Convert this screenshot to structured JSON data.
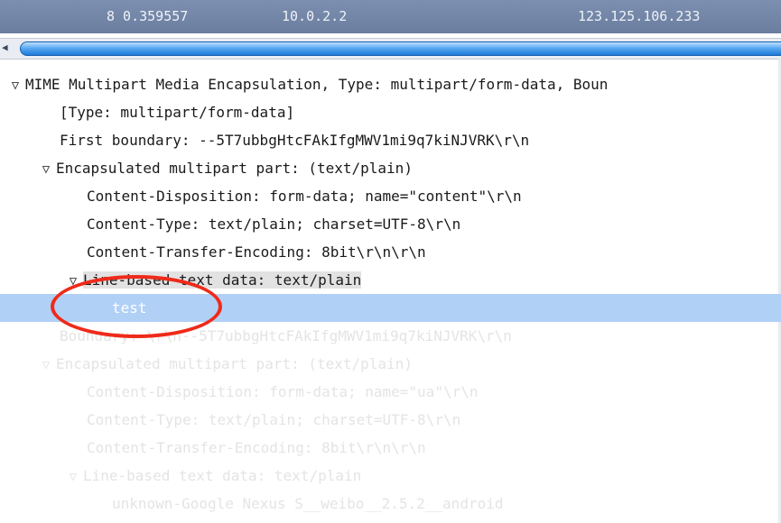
{
  "packet_row": {
    "number_time": "8 0.359557",
    "source": "10.0.2.2",
    "destination": "123.125.106.233"
  },
  "tree": {
    "mime_header": "MIME Multipart Media Encapsulation, Type: multipart/form-data, Boun",
    "type_line": "[Type: multipart/form-data]",
    "first_boundary": "First boundary: --5T7ubbgHtcFAkIfgMWV1mi9q7kiNJVRK\\r\\n",
    "part1": {
      "label": "Encapsulated multipart part:  (text/plain)",
      "disposition": "Content-Disposition: form-data; name=\"content\"\\r\\n",
      "content_type": "Content-Type: text/plain; charset=UTF-8\\r\\n",
      "encoding": "Content-Transfer-Encoding: 8bit\\r\\n\\r\\n",
      "text_data": "Line-based text data: text/plain",
      "value": "test"
    },
    "boundary": "Boundary: \\r\\n--5T7ubbgHtcFAkIfgMWV1mi9q7kiNJVRK\\r\\n",
    "part2": {
      "label": "Encapsulated multipart part:  (text/plain)",
      "disposition": "Content-Disposition: form-data; name=\"ua\"\\r\\n",
      "content_type": "Content-Type: text/plain; charset=UTF-8\\r\\n",
      "encoding": "Content-Transfer-Encoding: 8bit\\r\\n\\r\\n",
      "text_data": "Line-based text data: text/plain",
      "value": "unknown-Google Nexus S__weibo__2.5.2__android"
    }
  },
  "icons": {
    "expanded": "triangle-down-icon",
    "scroll_left": "scroll-left-arrow-icon"
  },
  "colors": {
    "selection": "#b0d0f6",
    "annotation": "#ef2a1a",
    "packet_row": "#7c8fb0"
  }
}
